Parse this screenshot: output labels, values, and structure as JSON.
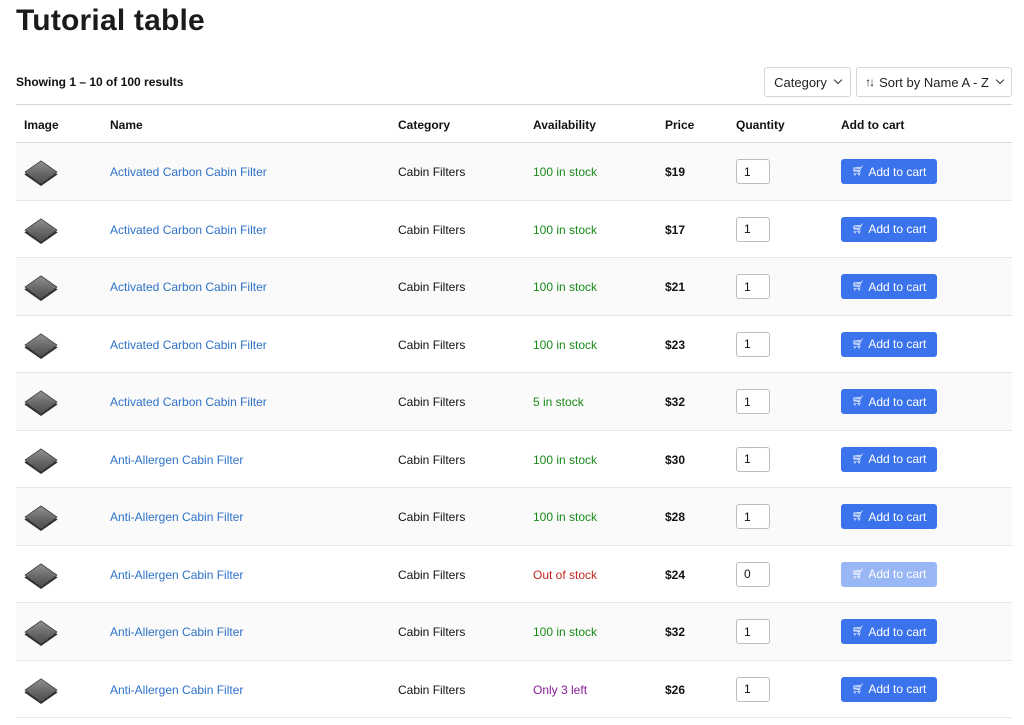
{
  "title": "Tutorial table",
  "results_text": "Showing 1 – 10 of 100 results",
  "filters": {
    "category_label": "Category",
    "sort_label": "Sort by Name A - Z"
  },
  "columns": {
    "image": "Image",
    "name": "Name",
    "category": "Category",
    "availability": "Availability",
    "price": "Price",
    "quantity": "Quantity",
    "add_to_cart": "Add to cart"
  },
  "colors": {
    "link": "#2e72c8",
    "in_stock": "#1a8a1a",
    "out_of_stock": "#c0271f",
    "low_stock": "#8a1a9a",
    "button": "#3b73ec",
    "button_disabled": "#9ab7f5"
  },
  "rows": [
    {
      "name": "Activated Carbon Cabin Filter",
      "category": "Cabin Filters",
      "availability": "100 in stock",
      "status": "green",
      "price": "$19",
      "quantity": "1",
      "button": "Add to cart",
      "enabled": true,
      "icon": "cabin-filter-image"
    },
    {
      "name": "Activated Carbon Cabin Filter",
      "category": "Cabin Filters",
      "availability": "100 in stock",
      "status": "green",
      "price": "$17",
      "quantity": "1",
      "button": "Add to cart",
      "enabled": true,
      "icon": "cabin-filter-image"
    },
    {
      "name": "Activated Carbon Cabin Filter",
      "category": "Cabin Filters",
      "availability": "100 in stock",
      "status": "green",
      "price": "$21",
      "quantity": "1",
      "button": "Add to cart",
      "enabled": true,
      "icon": "cabin-filter-image"
    },
    {
      "name": "Activated Carbon Cabin Filter",
      "category": "Cabin Filters",
      "availability": "100 in stock",
      "status": "green",
      "price": "$23",
      "quantity": "1",
      "button": "Add to cart",
      "enabled": true,
      "icon": "cabin-filter-image"
    },
    {
      "name": "Activated Carbon Cabin Filter",
      "category": "Cabin Filters",
      "availability": "5 in stock",
      "status": "green",
      "price": "$32",
      "quantity": "1",
      "button": "Add to cart",
      "enabled": true,
      "icon": "cabin-filter-image"
    },
    {
      "name": "Anti-Allergen Cabin Filter",
      "category": "Cabin Filters",
      "availability": "100 in stock",
      "status": "green",
      "price": "$30",
      "quantity": "1",
      "button": "Add to cart",
      "enabled": true,
      "icon": "cabin-filter-image"
    },
    {
      "name": "Anti-Allergen Cabin Filter",
      "category": "Cabin Filters",
      "availability": "100 in stock",
      "status": "green",
      "price": "$28",
      "quantity": "1",
      "button": "Add to cart",
      "enabled": true,
      "icon": "cabin-filter-image"
    },
    {
      "name": "Anti-Allergen Cabin Filter",
      "category": "Cabin Filters",
      "availability": "Out of stock",
      "status": "red",
      "price": "$24",
      "quantity": "0",
      "button": "Add to cart",
      "enabled": false,
      "icon": "cabin-filter-image"
    },
    {
      "name": "Anti-Allergen Cabin Filter",
      "category": "Cabin Filters",
      "availability": "100 in stock",
      "status": "green",
      "price": "$32",
      "quantity": "1",
      "button": "Add to cart",
      "enabled": true,
      "icon": "cabin-filter-image"
    },
    {
      "name": "Anti-Allergen Cabin Filter",
      "category": "Cabin Filters",
      "availability": "Only 3 left",
      "status": "purple",
      "price": "$26",
      "quantity": "1",
      "button": "Add to cart",
      "enabled": true,
      "icon": "cabin-filter-image"
    }
  ]
}
